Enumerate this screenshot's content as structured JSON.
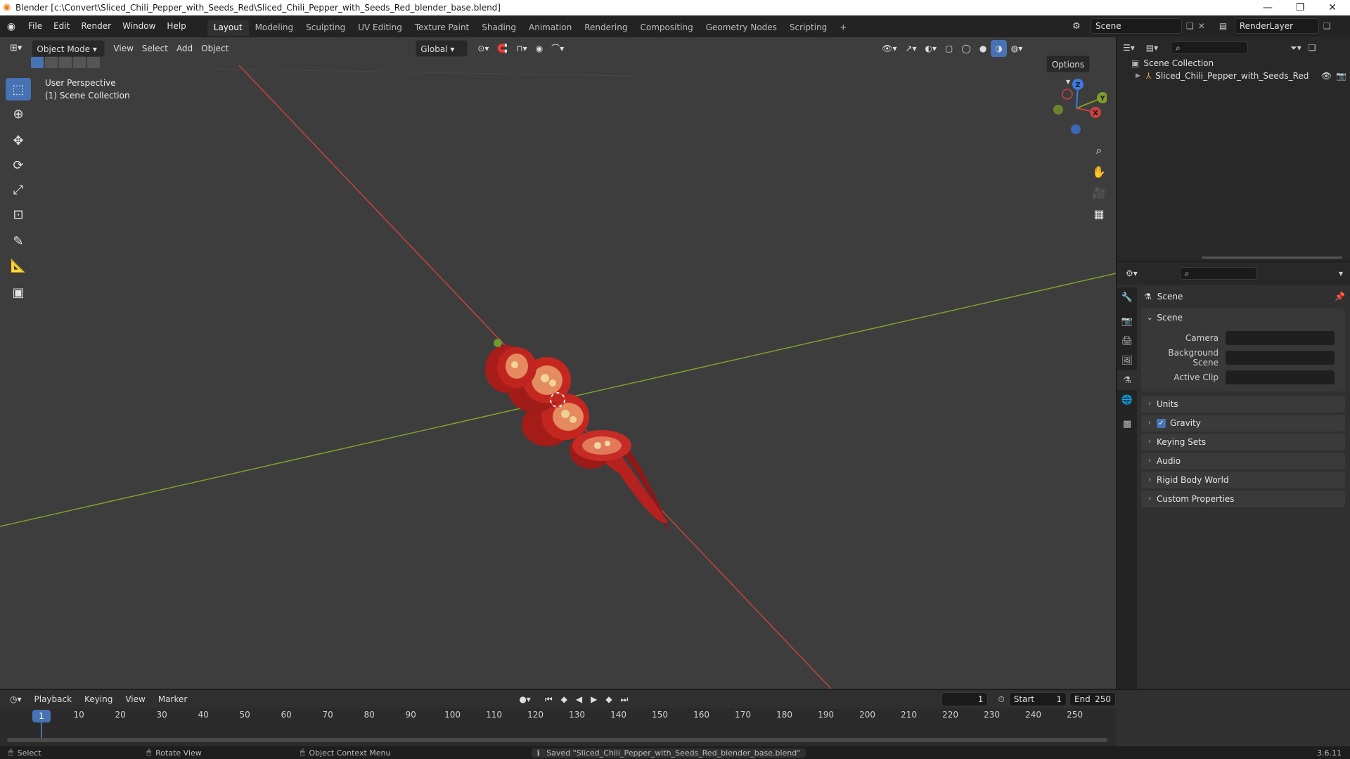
{
  "window": {
    "title": "Blender [c:\\Convert\\Sliced_Chili_Pepper_with_Seeds_Red\\Sliced_Chili_Pepper_with_Seeds_Red_blender_base.blend]",
    "minimize": "—",
    "maximize": "❐",
    "close": "✕"
  },
  "menu": [
    "File",
    "Edit",
    "Render",
    "Window",
    "Help"
  ],
  "workspaces": [
    "Layout",
    "Modeling",
    "Sculpting",
    "UV Editing",
    "Texture Paint",
    "Shading",
    "Animation",
    "Rendering",
    "Compositing",
    "Geometry Nodes",
    "Scripting"
  ],
  "active_workspace": "Layout",
  "add_workspace": "+",
  "scene_name": "Scene",
  "render_layer": "RenderLayer",
  "viewport": {
    "mode": "Object Mode",
    "header_menus": [
      "View",
      "Select",
      "Add",
      "Object"
    ],
    "transform_orientation": "Global",
    "options_label": "Options",
    "perspective_label": "User Perspective",
    "collection_label": "(1) Scene Collection",
    "gizmo": {
      "x": "X",
      "y": "Y",
      "z": "Z"
    }
  },
  "tools": [
    "select-box",
    "cursor",
    "move",
    "rotate",
    "scale",
    "transform",
    "annotate",
    "measure",
    "add-cube"
  ],
  "outliner": {
    "root": "Scene Collection",
    "items": [
      {
        "name": "Sliced_Chili_Pepper_with_Seeds_Red"
      }
    ]
  },
  "properties": {
    "header": "Scene",
    "section": "Scene",
    "fields": [
      {
        "label": "Camera",
        "value": ""
      },
      {
        "label": "Background Scene",
        "value": ""
      },
      {
        "label": "Active Clip",
        "value": ""
      }
    ],
    "panels": [
      {
        "label": "Units",
        "checkbox": false
      },
      {
        "label": "Gravity",
        "checkbox": true
      },
      {
        "label": "Keying Sets",
        "checkbox": false
      },
      {
        "label": "Audio",
        "checkbox": false
      },
      {
        "label": "Rigid Body World",
        "checkbox": false
      },
      {
        "label": "Custom Properties",
        "checkbox": false
      }
    ]
  },
  "timeline": {
    "menus": [
      "Playback",
      "Keying",
      "View",
      "Marker"
    ],
    "current_frame": "1",
    "start_label": "Start",
    "start": "1",
    "end_label": "End",
    "end": "250",
    "ticks": [
      "1",
      "10",
      "20",
      "30",
      "40",
      "50",
      "60",
      "70",
      "80",
      "90",
      "100",
      "110",
      "120",
      "130",
      "140",
      "150",
      "160",
      "170",
      "180",
      "190",
      "200",
      "210",
      "220",
      "230",
      "240",
      "250"
    ]
  },
  "status": {
    "select": "Select",
    "rotate": "Rotate View",
    "context": "Object Context Menu",
    "message": "Saved \"Sliced_Chili_Pepper_with_Seeds_Red_blender_base.blend\"",
    "version": "3.6.11"
  },
  "colors": {
    "accent": "#4772b3",
    "x_axis": "#c8413f",
    "y_axis": "#7fa02c",
    "z_axis": "#3b7be6",
    "chili": "#b5211e"
  }
}
